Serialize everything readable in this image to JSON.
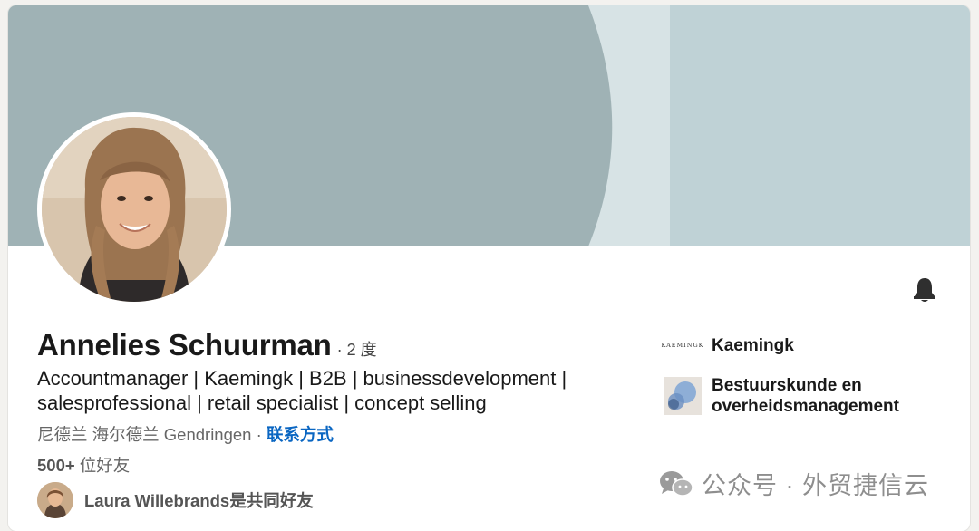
{
  "profile": {
    "name": "Annelies Schuurman",
    "degree": "· 2 度",
    "headline_line1": "Accountmanager | Kaemingk | B2B | businessdevelopment |",
    "headline_line2": "salesprofessional | retail specialist | concept selling",
    "location": "尼德兰 海尔德兰 Gendringen",
    "location_sep": " · ",
    "contact_label": "联系方式",
    "friends_count": "500+",
    "friends_label": " 位好友",
    "mutual_text": "Laura Willebrands是共同好友"
  },
  "sidebar": {
    "company_logo_text": "KAEMINGK",
    "company": "Kaemingk",
    "education_line1": "Bestuurskunde en",
    "education_line2": "overheidsmanagement"
  },
  "icons": {
    "bell": "bell-icon",
    "company": "kaemingk-logo",
    "education": "school-logo",
    "watermark": "wechat-icon"
  },
  "colors": {
    "banner_main": "#9fb2b5",
    "banner_light": "#d7e3e5",
    "banner_right": "#bfd2d6",
    "link": "#0a66c2"
  },
  "watermark": {
    "text": "公众号 · 外贸捷信云"
  }
}
